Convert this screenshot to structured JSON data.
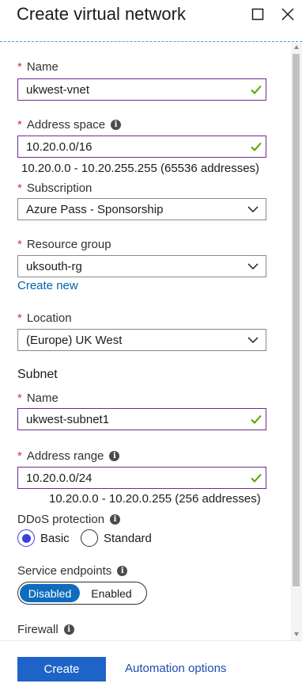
{
  "header": {
    "title": "Create virtual network",
    "maximize_icon": "maximize-icon",
    "close_icon": "close-icon"
  },
  "form": {
    "name": {
      "label": "Name",
      "value": "ukwest-vnet"
    },
    "address_space": {
      "label": "Address space",
      "value": "10.20.0.0/16",
      "hint": "10.20.0.0 - 10.20.255.255 (65536 addresses)"
    },
    "subscription": {
      "label": "Subscription",
      "value": "Azure Pass - Sponsorship"
    },
    "resource_group": {
      "label": "Resource group",
      "value": "uksouth-rg",
      "create_new": "Create new"
    },
    "location": {
      "label": "Location",
      "value": "(Europe) UK West"
    },
    "subnet": {
      "heading": "Subnet",
      "name": {
        "label": "Name",
        "value": "ukwest-subnet1"
      },
      "address_range": {
        "label": "Address range",
        "value": "10.20.0.0/24",
        "hint": "10.20.0.0 - 10.20.0.255 (256 addresses)"
      }
    },
    "ddos": {
      "label": "DDoS protection",
      "options": [
        "Basic",
        "Standard"
      ],
      "selected": "Basic"
    },
    "service_endpoints": {
      "label": "Service endpoints",
      "options": [
        "Disabled",
        "Enabled"
      ],
      "selected": "Disabled"
    },
    "firewall": {
      "label": "Firewall"
    }
  },
  "footer": {
    "create_label": "Create",
    "automation_label": "Automation options"
  },
  "colors": {
    "accent": "#1e64c8",
    "required": "#d13438",
    "valid_check": "#57a300",
    "field_border": "#6b2c91",
    "link": "#0062ad"
  }
}
